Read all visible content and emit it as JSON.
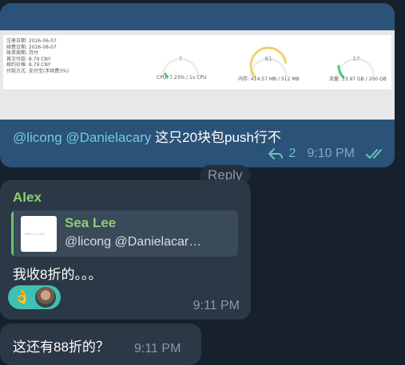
{
  "outgoing": {
    "screenshot": {
      "info_lines": [
        "注册日期: 2026-06-07",
        "续费日期: 2026-08-07",
        "账单周期: 月付",
        "首次付款: 8.79 CNY",
        "续约价格: 8.79 CNY",
        "付款方式: 支付宝(手续费3%)"
      ],
      "gauges": [
        {
          "value": "7",
          "caption": "CPU:  7.23% / 1v CPU",
          "color": "#58c86e",
          "fraction": 0.07
        },
        {
          "value": "81",
          "caption": "内存:  414.57 MB / 512 MB",
          "color": "#f2d06a",
          "fraction": 0.81
        },
        {
          "value": "17",
          "caption": "流量:  33.97 GB / 200 GB",
          "color": "#58c86e",
          "fraction": 0.17
        }
      ]
    },
    "mentions": "@licong @Danielacary",
    "text": " 这只20块包push行不",
    "reply_count": "2",
    "time": "9:10 PM"
  },
  "reply_pill": "Reply",
  "incoming": {
    "sender": "Alex",
    "quote": {
      "name": "Sea Lee",
      "text": "@licong @Danielacar…",
      "thumb_caption": "729% / 1v CPU"
    },
    "text": "我收8折的。。。",
    "reaction_emoji": "👌",
    "time": "9:11 PM"
  },
  "incoming2": {
    "text": "这还有88折的？",
    "time": "9:11 PM"
  }
}
